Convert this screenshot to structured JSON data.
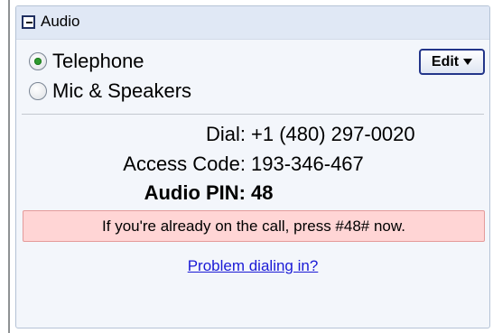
{
  "panel": {
    "title": "Audio",
    "collapse_icon": "minus-box-icon"
  },
  "audio_options": {
    "telephone_label": "Telephone",
    "mic_label": "Mic & Speakers",
    "selected": "Telephone",
    "edit_label": "Edit",
    "edit_icon": "caret-down-icon"
  },
  "dial_info": {
    "dial_label": "Dial:",
    "dial_value": "+1 (480) 297-0020",
    "access_label": "Access Code:",
    "access_value": "193-346-467",
    "pin_label": "Audio PIN:",
    "pin_value": "48"
  },
  "notice": {
    "text": "If you're already on the call, press #48# now.",
    "color": "#ffd5d5"
  },
  "links": {
    "problem_dialing": "Problem dialing in?"
  },
  "colors": {
    "panel_border": "#b5c3d6",
    "header_bg": "#e0e8f5",
    "link": "#1a1ad6",
    "radio_selected": "#2e9a2e"
  }
}
